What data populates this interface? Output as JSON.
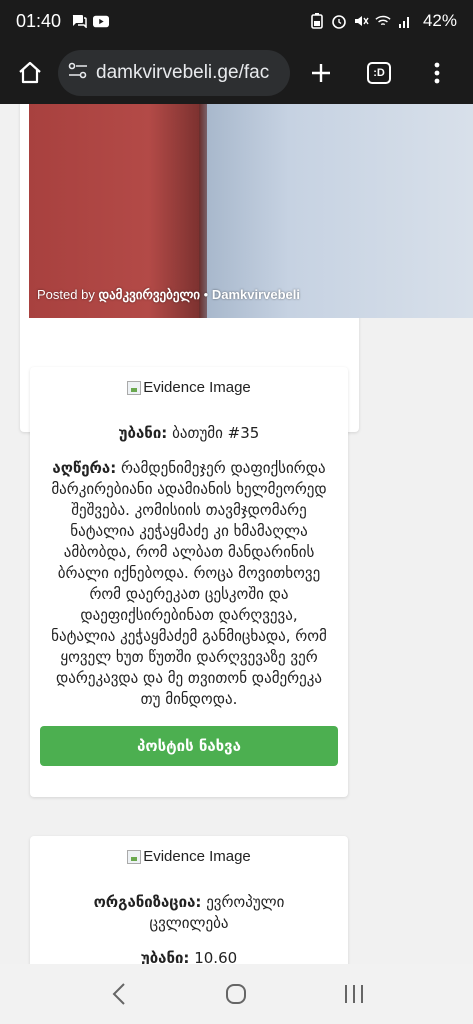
{
  "status_bar": {
    "time": "01:40",
    "battery": "42%"
  },
  "browser": {
    "url": "damkvirvebeli.ge/fac",
    "tab_label": ":D"
  },
  "top_post": {
    "posted_prefix": "Posted by",
    "author": "დამკვირვებელი",
    "separator": "•",
    "author_latin": "Damkvirvebeli"
  },
  "card1": {
    "image_alt": "Evidence Image",
    "location_label": "უბანი:",
    "location_value": "ბათუმი #35",
    "description_label": "აღწერა:",
    "description_value": "რამდენიმეჯერ დაფიქსირდა მარკირებიანი ადამიანის ხელმეორედ შეშვება. კომისიის თავმჯდომარე ნატალია კეჭაყმაძე კი ხმამაღლა ამბობდა, რომ ალბათ მანდარინის ბრალი იქნებოდა. როცა მოვითხოვე რომ დაერეკათ ცესკოში და დაეფიქსირებინათ დარღვევა, ნატალია კეჭაყმაძემ განმიცხადა, რომ ყოველ ხუთ წუთში დარღვევაზე ვერ დარეკავდა და მე თვითონ დამერეკა თუ მინდოდა.",
    "button_label": "პოსტის ნახვა"
  },
  "card2": {
    "image_alt": "Evidence Image",
    "org_label": "ორგანიზაცია:",
    "org_value": "ევროპული ცვლილება",
    "location_label": "უბანი:",
    "location_value": "10.60"
  },
  "colors": {
    "button": "#4caf50",
    "chrome": "#1b1b1b"
  }
}
